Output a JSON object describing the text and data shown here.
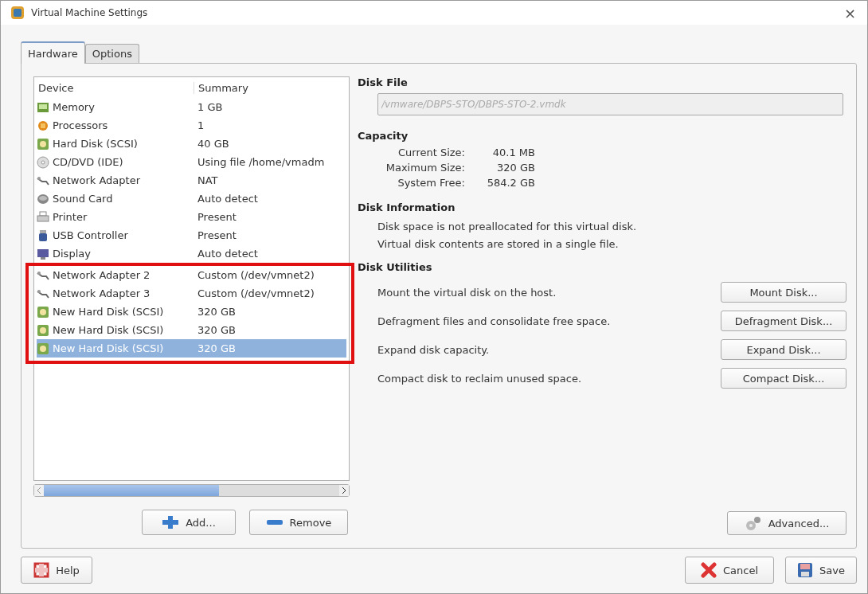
{
  "window": {
    "title": "Virtual Machine Settings",
    "close": "×"
  },
  "tabs": [
    {
      "label": "Hardware",
      "selected": true
    },
    {
      "label": "Options",
      "selected": false
    }
  ],
  "device_list": {
    "columns": [
      "Device",
      "Summary"
    ],
    "rows": [
      {
        "kind": "memory",
        "device": "Memory",
        "summary": "1 GB",
        "selected": false,
        "marked": false
      },
      {
        "kind": "processor",
        "device": "Processors",
        "summary": "1",
        "selected": false,
        "marked": false
      },
      {
        "kind": "disk",
        "device": "Hard Disk (SCSI)",
        "summary": "40 GB",
        "selected": false,
        "marked": false
      },
      {
        "kind": "cdrom",
        "device": "CD/DVD (IDE)",
        "summary": "Using file /home/vmadm",
        "selected": false,
        "marked": false
      },
      {
        "kind": "network",
        "device": "Network Adapter",
        "summary": "NAT",
        "selected": false,
        "marked": false
      },
      {
        "kind": "sound",
        "device": "Sound Card",
        "summary": "Auto detect",
        "selected": false,
        "marked": false
      },
      {
        "kind": "printer",
        "device": "Printer",
        "summary": "Present",
        "selected": false,
        "marked": false
      },
      {
        "kind": "usb",
        "device": "USB Controller",
        "summary": "Present",
        "selected": false,
        "marked": false
      },
      {
        "kind": "display",
        "device": "Display",
        "summary": "Auto detect",
        "selected": false,
        "marked": false
      },
      {
        "kind": "network",
        "device": "Network Adapter 2",
        "summary": "Custom (/dev/vmnet2)",
        "selected": false,
        "marked": true
      },
      {
        "kind": "network",
        "device": "Network Adapter 3",
        "summary": "Custom (/dev/vmnet2)",
        "selected": false,
        "marked": true
      },
      {
        "kind": "disk",
        "device": "New Hard Disk (SCSI)",
        "summary": "320 GB",
        "selected": false,
        "marked": true
      },
      {
        "kind": "disk",
        "device": "New Hard Disk (SCSI)",
        "summary": "320 GB",
        "selected": false,
        "marked": true
      },
      {
        "kind": "disk",
        "device": "New Hard Disk (SCSI)",
        "summary": "320 GB",
        "selected": true,
        "marked": true
      }
    ]
  },
  "list_buttons": [
    {
      "kind": "add",
      "label": "Add..."
    },
    {
      "kind": "remove",
      "label": "Remove"
    }
  ],
  "disk_file": {
    "heading": "Disk File",
    "value": "/vmware/DBPS-STO/DBPS-STO-2.vmdk",
    "disabled": true
  },
  "capacity": {
    "heading": "Capacity",
    "items": [
      {
        "label": "Current Size:",
        "value": "40.1 MB"
      },
      {
        "label": "Maximum Size:",
        "value": "320 GB"
      },
      {
        "label": "System Free:",
        "value": "584.2 GB"
      }
    ]
  },
  "disk_information": {
    "heading": "Disk Information",
    "lines": [
      "Disk space is not preallocated for this virtual disk.",
      "Virtual disk contents are stored in a single file."
    ]
  },
  "disk_utilities": {
    "heading": "Disk Utilities",
    "items": [
      {
        "text": "Mount the virtual disk on the host.",
        "button": "Mount Disk..."
      },
      {
        "text": "Defragment files and consolidate free space.",
        "button": "Defragment Disk..."
      },
      {
        "text": "Expand disk capacity.",
        "button": "Expand Disk..."
      },
      {
        "text": "Compact disk to reclaim unused space.",
        "button": "Compact Disk..."
      }
    ]
  },
  "advanced_button": {
    "label": "Advanced..."
  },
  "footer_buttons": [
    {
      "kind": "help",
      "label": "Help"
    },
    {
      "kind": "cancel",
      "label": "Cancel"
    },
    {
      "kind": "save",
      "label": "Save"
    }
  ]
}
